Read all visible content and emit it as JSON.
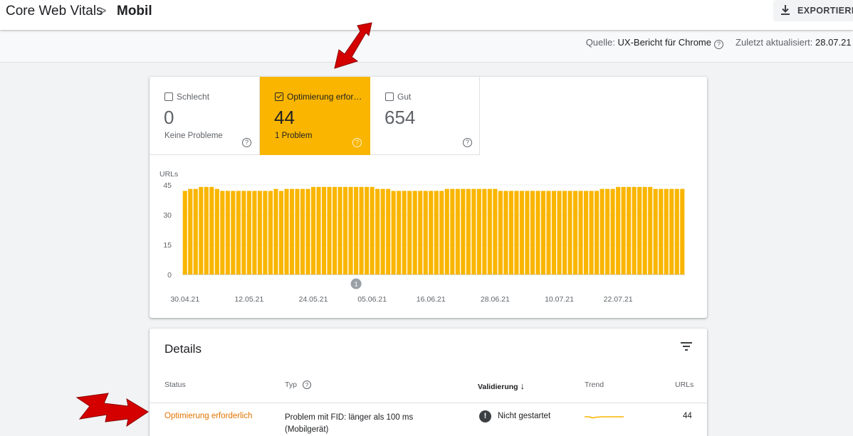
{
  "breadcrumb": {
    "root": "Core Web Vitals",
    "separator": ">",
    "current": "Mobil"
  },
  "toolbar": {
    "export_label": "EXPORTIEREN",
    "export_icon": "download-icon"
  },
  "meta": {
    "source_label": "Quelle:",
    "source_value": "UX-Bericht für Chrome",
    "updated_label": "Zuletzt aktualisiert:",
    "updated_value": "28.07.21"
  },
  "tiles": {
    "bad": {
      "label": "Schlecht",
      "value": "0",
      "sub": "Keine Probleme",
      "checked": false
    },
    "needs_improvement": {
      "label": "Optimierung erfor…",
      "value": "44",
      "sub": "1 Problem",
      "checked": true
    },
    "good": {
      "label": "Gut",
      "value": "654",
      "sub": "",
      "checked": false
    }
  },
  "colors": {
    "accent": "#f9b500",
    "status_text": "#e37400",
    "annotation_arrow": "#d40000"
  },
  "chart_data": {
    "type": "bar",
    "ylabel": "URLs",
    "ylim": [
      0,
      45
    ],
    "yticks": [
      0,
      15,
      30,
      45
    ],
    "grid": true,
    "x_tick_labels": [
      "30.04.21",
      "12.05.21",
      "24.05.21",
      "05.06.21",
      "16.06.21",
      "28.06.21",
      "10.07.21",
      "22.07.21"
    ],
    "x_tick_index": [
      0,
      12,
      24,
      35,
      46,
      58,
      70,
      81
    ],
    "annotation": {
      "label": "1",
      "index": 32
    },
    "values": [
      42,
      43,
      43,
      44,
      44,
      44,
      43,
      42,
      42,
      42,
      42,
      42,
      42,
      42,
      42,
      42,
      42,
      43,
      42,
      43,
      43,
      43,
      43,
      43,
      44,
      44,
      44,
      44,
      44,
      44,
      44,
      44,
      44,
      44,
      44,
      44,
      43,
      43,
      43,
      42,
      42,
      42,
      42,
      42,
      42,
      42,
      42,
      42,
      42,
      43,
      43,
      43,
      43,
      43,
      43,
      43,
      43,
      43,
      43,
      42,
      42,
      42,
      42,
      42,
      42,
      42,
      42,
      42,
      42,
      42,
      42,
      42,
      42,
      42,
      42,
      42,
      42,
      42,
      43,
      43,
      43,
      44,
      44,
      44,
      44,
      44,
      44,
      44,
      43,
      43,
      43,
      43,
      43,
      43
    ]
  },
  "details": {
    "title": "Details",
    "filter_icon": "filter-icon",
    "columns": {
      "status": "Status",
      "type": "Typ",
      "validation": "Validierung",
      "trend": "Trend",
      "urls": "URLs"
    },
    "rows": [
      {
        "status": "Optimierung erforderlich",
        "type": "Problem mit FID: länger als 100 ms (Mobilgerät)",
        "validation": "Nicht gestartet",
        "urls": "44"
      }
    ]
  }
}
